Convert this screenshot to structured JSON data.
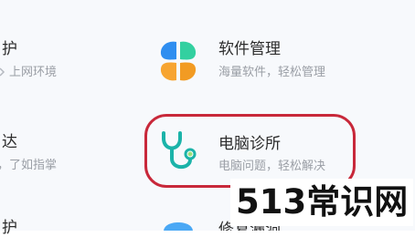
{
  "left_column": [
    {
      "title": "护",
      "desc": "上网环境"
    },
    {
      "title": "达",
      "desc": "，了如指掌"
    },
    {
      "title": "护"
    }
  ],
  "right_column": [
    {
      "title": "软件管理",
      "desc": "海量软件，轻松管理",
      "icon": "clover-icon"
    },
    {
      "title": "电脑诊所",
      "desc": "电脑问题，轻松解决",
      "icon": "stethoscope-icon"
    },
    {
      "title": "修复漏洞",
      "icon": "shield-icon"
    }
  ],
  "watermark": {
    "text": "513常识网"
  },
  "colors": {
    "highlight_border": "#c8283a",
    "title_text": "#2c2c2c",
    "desc_text": "#9a9ea5",
    "panel_bg": "#f7f9fc",
    "clover_blue": "#2f8ef0",
    "clover_green": "#33d0a0",
    "clover_orange": "#f7a531",
    "stethoscope_teal": "#1bb3a9"
  }
}
